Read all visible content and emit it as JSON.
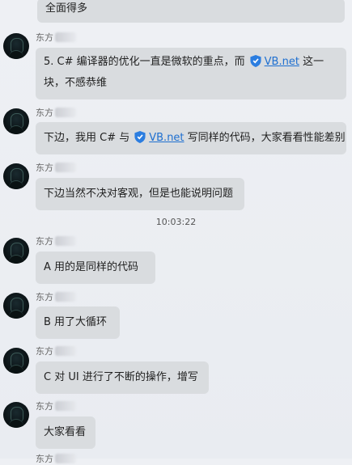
{
  "messages": [
    {
      "id": "m0",
      "sender": "",
      "text": "全面得多"
    },
    {
      "id": "m1",
      "sender": "东方",
      "text_before": "5.  C# 编译器的优化一直是微软的重点，而",
      "link": "VB.net",
      "text_after": "这一块，不感恭维"
    },
    {
      "id": "m2",
      "sender": "东方",
      "text_before": "下边，我用 C# 与",
      "link": "VB.net",
      "text_after": "写同样的代码，大家看看性能差别"
    },
    {
      "id": "m3",
      "sender": "东方",
      "text": "下边当然不决对客观，但是也能说明问题"
    },
    {
      "id": "m4",
      "sender": "东方",
      "text": "A   用的是同样的代码"
    },
    {
      "id": "m5",
      "sender": "东方",
      "text": "B  用了大循环"
    },
    {
      "id": "m6",
      "sender": "东方",
      "text": "C 对 UI 进行了不断的操作，增写"
    },
    {
      "id": "m7",
      "sender": "东方",
      "text": "大家看看"
    },
    {
      "id": "m8",
      "sender": "东方"
    }
  ],
  "timestamp": "10:03:22",
  "colors": {
    "bubble": "#d9dcdf",
    "link": "#1e6fd0",
    "shield": "#2b7de0"
  },
  "icons": {
    "link_shield": "security-shield-icon"
  }
}
